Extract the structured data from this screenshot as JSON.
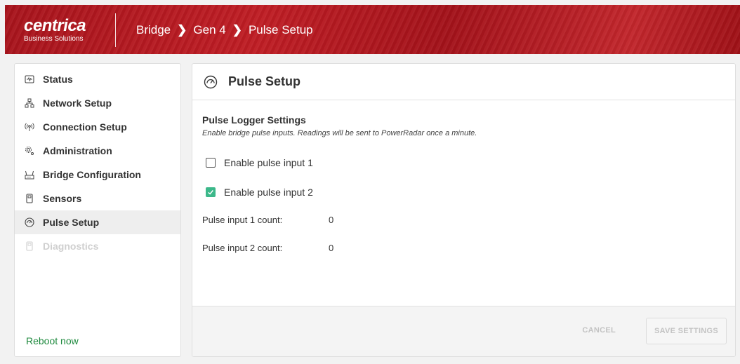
{
  "header": {
    "logo_brand": "centrica",
    "logo_sub": "Business Solutions",
    "breadcrumb": [
      "Bridge",
      "Gen 4",
      "Pulse Setup"
    ]
  },
  "sidebar": {
    "items": [
      {
        "label": "Status",
        "icon": "status-icon"
      },
      {
        "label": "Network Setup",
        "icon": "network-icon"
      },
      {
        "label": "Connection Setup",
        "icon": "wireless-icon"
      },
      {
        "label": "Administration",
        "icon": "gears-icon"
      },
      {
        "label": "Bridge Configuration",
        "icon": "router-icon"
      },
      {
        "label": "Sensors",
        "icon": "sensor-icon"
      },
      {
        "label": "Pulse Setup",
        "icon": "gauge-icon",
        "active": true
      },
      {
        "label": "Diagnostics",
        "icon": "sensor-icon",
        "disabled": true
      }
    ],
    "reboot_label": "Reboot now"
  },
  "panel": {
    "title": "Pulse Setup",
    "section_title": "Pulse Logger Settings",
    "section_desc": "Enable bridge pulse inputs. Readings will be sent to PowerRadar once a minute.",
    "checkboxes": [
      {
        "label": "Enable pulse input 1",
        "checked": false
      },
      {
        "label": "Enable pulse input 2",
        "checked": true
      }
    ],
    "counts": [
      {
        "label": "Pulse input 1 count:",
        "value": "0"
      },
      {
        "label": "Pulse input 2 count:",
        "value": "0"
      }
    ],
    "cancel_label": "CANCEL",
    "save_label": "SAVE SETTINGS"
  },
  "colors": {
    "header_red": "#b5171f",
    "accent_green": "#1e8a3e",
    "checkbox_checked": "#3cb88a"
  }
}
